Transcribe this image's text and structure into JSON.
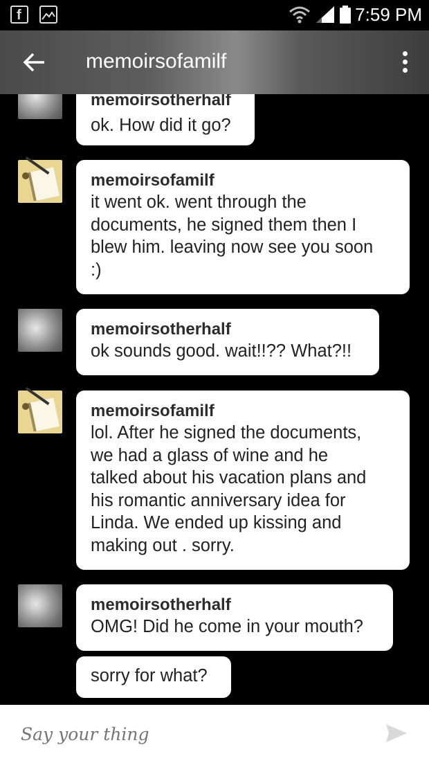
{
  "status_bar": {
    "time": "7:59 PM",
    "notification_icons": [
      "facebook-icon",
      "image-icon"
    ],
    "indicators": [
      "wifi-icon",
      "signal-icon",
      "battery-icon"
    ]
  },
  "header": {
    "title": "memoirsofamilf",
    "back_icon": "arrow-left-icon",
    "menu_icon": "more-vertical-icon"
  },
  "chat": {
    "messages": [
      {
        "sender": "memoirsotherhalf",
        "text": "ok. How did it go?"
      },
      {
        "sender": "memoirsofamilf",
        "lines": [
          "it went ok. went through the",
          "documents, he signed them then  I",
          "blew him. leaving now see you soon",
          ":)"
        ]
      },
      {
        "sender": "memoirsotherhalf",
        "text": "ok sounds good. wait!!?? What?!!"
      },
      {
        "sender": "memoirsofamilf",
        "lines": [
          "lol. After he signed the documents,",
          "we had a glass of wine and he",
          "talked about his vacation plans and",
          "his romantic anniversary idea for",
          "Linda. We ended up kissing and",
          "making out .  sorry."
        ]
      },
      {
        "sender": "memoirsotherhalf",
        "text": "OMG! Did he come in your mouth?"
      },
      {
        "sender": "",
        "text": "sorry for what?"
      }
    ]
  },
  "composer": {
    "placeholder": "Say your thing",
    "send_icon": "send-icon"
  },
  "colors": {
    "background": "#000000",
    "bubble": "#ffffff",
    "header": "#5e5e5e"
  }
}
